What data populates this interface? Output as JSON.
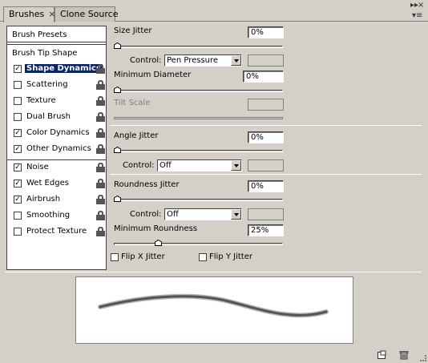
{
  "tabs": [
    {
      "label": "Brushes",
      "close": "×"
    },
    {
      "label": "Clone Source"
    }
  ],
  "window_controls": {
    "min": "▸▸",
    "close": "×",
    "menu": "▾≡"
  },
  "left": {
    "brush_presets": "Brush Presets",
    "brush_tip_shape": "Brush Tip Shape",
    "options": [
      {
        "label": "Shape Dynamics",
        "checked": "✓",
        "selected": true
      },
      {
        "label": "Scattering",
        "checked": ""
      },
      {
        "label": "Texture",
        "checked": ""
      },
      {
        "label": "Dual Brush",
        "checked": ""
      },
      {
        "label": "Color Dynamics",
        "checked": "✓"
      },
      {
        "label": "Other Dynamics",
        "checked": "✓"
      },
      {
        "label": "Noise",
        "checked": "✓"
      },
      {
        "label": "Wet Edges",
        "checked": "✓"
      },
      {
        "label": "Airbrush",
        "checked": "✓"
      },
      {
        "label": "Smoothing",
        "checked": ""
      },
      {
        "label": "Protect Texture",
        "checked": ""
      }
    ]
  },
  "settings": {
    "size_jitter": {
      "label": "Size Jitter",
      "value": "0%",
      "level": 0
    },
    "size_control": {
      "label": "Control:",
      "value": "Pen Pressure"
    },
    "min_diameter": {
      "label": "Minimum Diameter",
      "value": "0%",
      "level": 0
    },
    "tilt_scale": {
      "label": "Tilt Scale"
    },
    "angle_jitter": {
      "label": "Angle Jitter",
      "value": "0%",
      "level": 0
    },
    "angle_control": {
      "label": "Control:",
      "value": "Off"
    },
    "roundness_jitter": {
      "label": "Roundness Jitter",
      "value": "0%",
      "level": 0
    },
    "roundness_control": {
      "label": "Control:",
      "value": "Off"
    },
    "min_roundness": {
      "label": "Minimum Roundness",
      "value": "25%",
      "level": 0.25
    },
    "flip_x": {
      "label": "Flip X Jitter"
    },
    "flip_y": {
      "label": "Flip Y Jitter"
    }
  },
  "colors": {
    "selection": "#0a246a",
    "panel": "#d4d0c8",
    "stroke": "#555555"
  }
}
